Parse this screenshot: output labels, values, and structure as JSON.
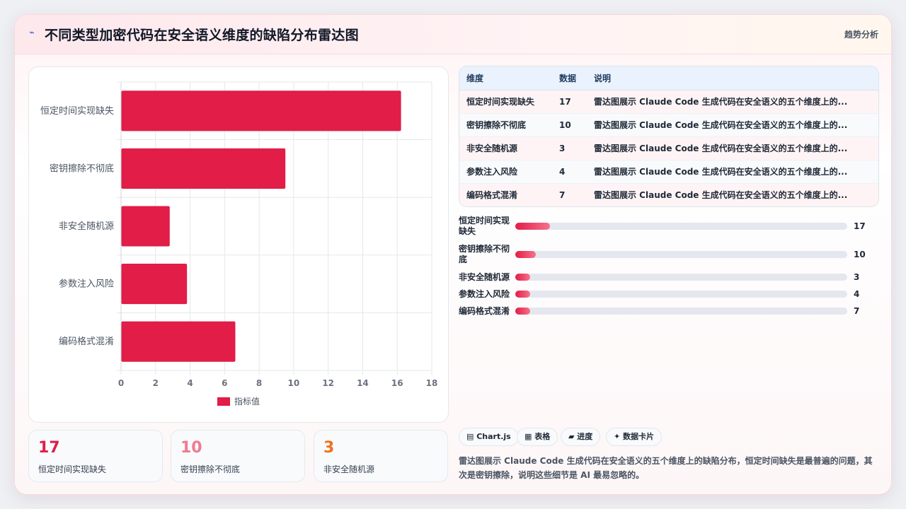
{
  "header": {
    "title": "不同类型加密代码在安全语义维度的缺陷分布雷达图",
    "title_icon": "chart-icon",
    "action": "趋势分析"
  },
  "chart_data": {
    "type": "bar",
    "orientation": "horizontal",
    "categories": [
      "恒定时间实现缺失",
      "密钥擦除不彻底",
      "非安全随机源",
      "参数注入风险",
      "编码格式混淆"
    ],
    "series": [
      {
        "name": "指标值",
        "values": [
          16.2,
          9.5,
          2.8,
          3.8,
          6.6
        ],
        "color": "#e11d48"
      }
    ],
    "xlim": [
      0,
      18
    ],
    "xticks": [
      0,
      2,
      4,
      6,
      8,
      10,
      12,
      14,
      16,
      18
    ],
    "grid": true,
    "legend": "bottom"
  },
  "kpis": [
    {
      "value": "17",
      "label": "恒定时间实现缺失",
      "color": "#e11d48"
    },
    {
      "value": "10",
      "label": "密钥擦除不彻底",
      "color": "#f07a8f"
    },
    {
      "value": "3",
      "label": "非安全随机源",
      "color": "#f2711c"
    }
  ],
  "table": {
    "headers": [
      "维度",
      "数据",
      "说明"
    ],
    "rows": [
      [
        "恒定时间实现缺失",
        "17",
        "雷达图展示 Claude Code 生成代码在安全语义的五个维度上的..."
      ],
      [
        "密钥擦除不彻底",
        "10",
        "雷达图展示 Claude Code 生成代码在安全语义的五个维度上的..."
      ],
      [
        "非安全随机源",
        "3",
        "雷达图展示 Claude Code 生成代码在安全语义的五个维度上的..."
      ],
      [
        "参数注入风险",
        "4",
        "雷达图展示 Claude Code 生成代码在安全语义的五个维度上的..."
      ],
      [
        "编码格式混淆",
        "7",
        "雷达图展示 Claude Code 生成代码在安全语义的五个维度上的..."
      ]
    ]
  },
  "progress": {
    "max": 17,
    "items": [
      {
        "label": "恒定时间实现缺失",
        "value": 17,
        "fraction": 0.105
      },
      {
        "label": "密钥擦除不彻底",
        "value": 10,
        "fraction": 0.062
      },
      {
        "label": "非安全随机源",
        "value": 3,
        "fraction": 0.045
      },
      {
        "label": "参数注入风险",
        "value": 4,
        "fraction": 0.045
      },
      {
        "label": "编码格式混淆",
        "value": 7,
        "fraction": 0.045
      }
    ]
  },
  "tags": [
    {
      "icon": "grid-icon",
      "label": "▤ Chart.js"
    },
    {
      "icon": "table-icon",
      "label": "▦ 表格"
    },
    {
      "icon": "progress-icon",
      "label": "▰ 进度"
    },
    {
      "icon": "sparkle-icon",
      "label": "✦ 数据卡片"
    }
  ],
  "description": "雷达图展示 Claude Code 生成代码在安全语义的五个维度上的缺陷分布，恒定时间缺失是最普遍的问题，其次是密钥擦除，说明这些细节是 AI 最易忽略的。"
}
